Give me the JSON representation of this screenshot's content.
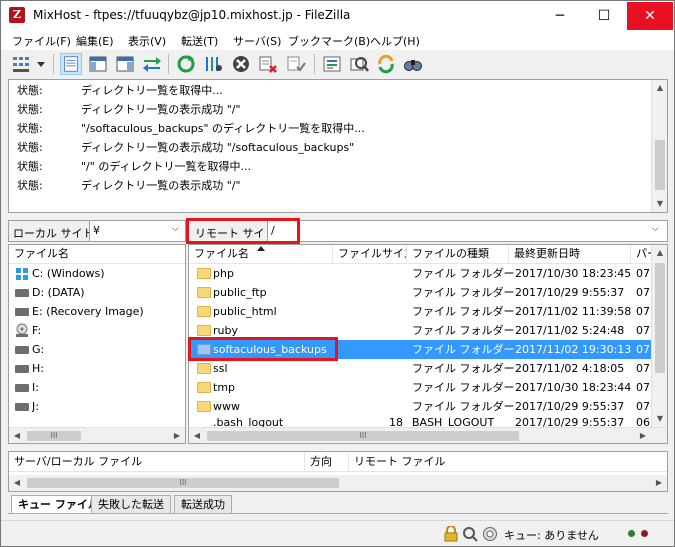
{
  "window": {
    "title": "MixHost - ftpes://tfuuqybz@jp10.mixhost.jp - FileZilla",
    "app_icon_letter": "Z",
    "minimize": "─",
    "maximize": "☐",
    "close": "✕"
  },
  "menu": [
    "ファイル(F)",
    "編集(E)",
    "表示(V)",
    "転送(T)",
    "サーバ(S)",
    "ブックマーク(B)",
    "ヘルプ(H)"
  ],
  "toolbar": {
    "icons": [
      "site-manager-icon",
      "dropdown-arrow-icon",
      "toggle-log-icon",
      "toggle-local-tree-icon",
      "toggle-remote-tree-icon",
      "toggle-queue-icon",
      "refresh-icon",
      "process-queue-icon",
      "cancel-icon",
      "disconnect-icon",
      "reconnect-icon",
      "filter-icon",
      "toggle-sync-browse-icon",
      "directory-compare-icon",
      "search-icon"
    ]
  },
  "log": {
    "lines": [
      {
        "label": "状態:",
        "text": "ディレクトリ一覧を取得中..."
      },
      {
        "label": "状態:",
        "text": "ディレクトリ一覧の表示成功 \"/\""
      },
      {
        "label": "状態:",
        "text": "\"/softaculous_backups\" のディレクトリ一覧を取得中..."
      },
      {
        "label": "状態:",
        "text": "ディレクトリ一覧の表示成功 \"/softaculous_backups\""
      },
      {
        "label": "状態:",
        "text": "\"/\" のディレクトリ一覧を取得中..."
      },
      {
        "label": "状態:",
        "text": "ディレクトリ一覧の表示成功 \"/\""
      }
    ]
  },
  "local": {
    "site_label": "ローカル サイト:",
    "site_value": "¥",
    "column_header": "ファイル名",
    "items": [
      {
        "label": "C: (Windows)",
        "icon": "windows-drive-icon"
      },
      {
        "label": "D: (DATA)",
        "icon": "drive-icon"
      },
      {
        "label": "E: (Recovery Image)",
        "icon": "drive-icon"
      },
      {
        "label": "F:",
        "icon": "optical-drive-icon"
      },
      {
        "label": "G:",
        "icon": "drive-icon"
      },
      {
        "label": "H:",
        "icon": "drive-icon"
      },
      {
        "label": "I:",
        "icon": "drive-icon"
      },
      {
        "label": "J:",
        "icon": "drive-icon"
      }
    ],
    "hscroll_thumb": "III"
  },
  "remote": {
    "site_label": "リモート サイト:",
    "site_value": "/",
    "columns": [
      "ファイル名",
      "ファイルサイズ",
      "ファイルの種類",
      "最終更新日時",
      "パー"
    ],
    "rows": [
      {
        "name": "php",
        "size": "",
        "type": "ファイル フォルダー",
        "modified": "2017/10/30 18:23:45",
        "perm": "07",
        "selected": false
      },
      {
        "name": "public_ftp",
        "size": "",
        "type": "ファイル フォルダー",
        "modified": "2017/10/29 9:55:37",
        "perm": "07",
        "selected": false
      },
      {
        "name": "public_html",
        "size": "",
        "type": "ファイル フォルダー",
        "modified": "2017/11/02 11:39:58",
        "perm": "07",
        "selected": false
      },
      {
        "name": "ruby",
        "size": "",
        "type": "ファイル フォルダー",
        "modified": "2017/11/02 5:24:48",
        "perm": "07",
        "selected": false
      },
      {
        "name": "softaculous_backups",
        "size": "",
        "type": "ファイル フォルダー",
        "modified": "2017/11/02 19:30:13",
        "perm": "07",
        "selected": true
      },
      {
        "name": "ssl",
        "size": "",
        "type": "ファイル フォルダー",
        "modified": "2017/11/02 4:18:05",
        "perm": "07",
        "selected": false
      },
      {
        "name": "tmp",
        "size": "",
        "type": "ファイル フォルダー",
        "modified": "2017/10/30 18:23:44",
        "perm": "07",
        "selected": false
      },
      {
        "name": "www",
        "size": "",
        "type": "ファイル フォルダー",
        "modified": "2017/10/29 9:55:37",
        "perm": "07",
        "selected": false
      },
      {
        "name": ".bash_logout",
        "size": "18",
        "type": "BASH_LOGOUT",
        "modified": "2017/10/29 9:55:37",
        "perm": "06",
        "selected": false
      }
    ],
    "hscroll_thumb": "III"
  },
  "queue": {
    "columns": [
      "サーバ/ローカル ファイル",
      "方向",
      "リモート ファイル"
    ],
    "hscroll_thumb": "III"
  },
  "tabs": [
    "キュー ファイル",
    "失敗した転送",
    "転送成功"
  ],
  "status": {
    "queue_text": "キュー: ありません"
  },
  "colors": {
    "selection": "#3399ff",
    "highlight_box": "#e8141a",
    "folder": "#f8d775"
  }
}
